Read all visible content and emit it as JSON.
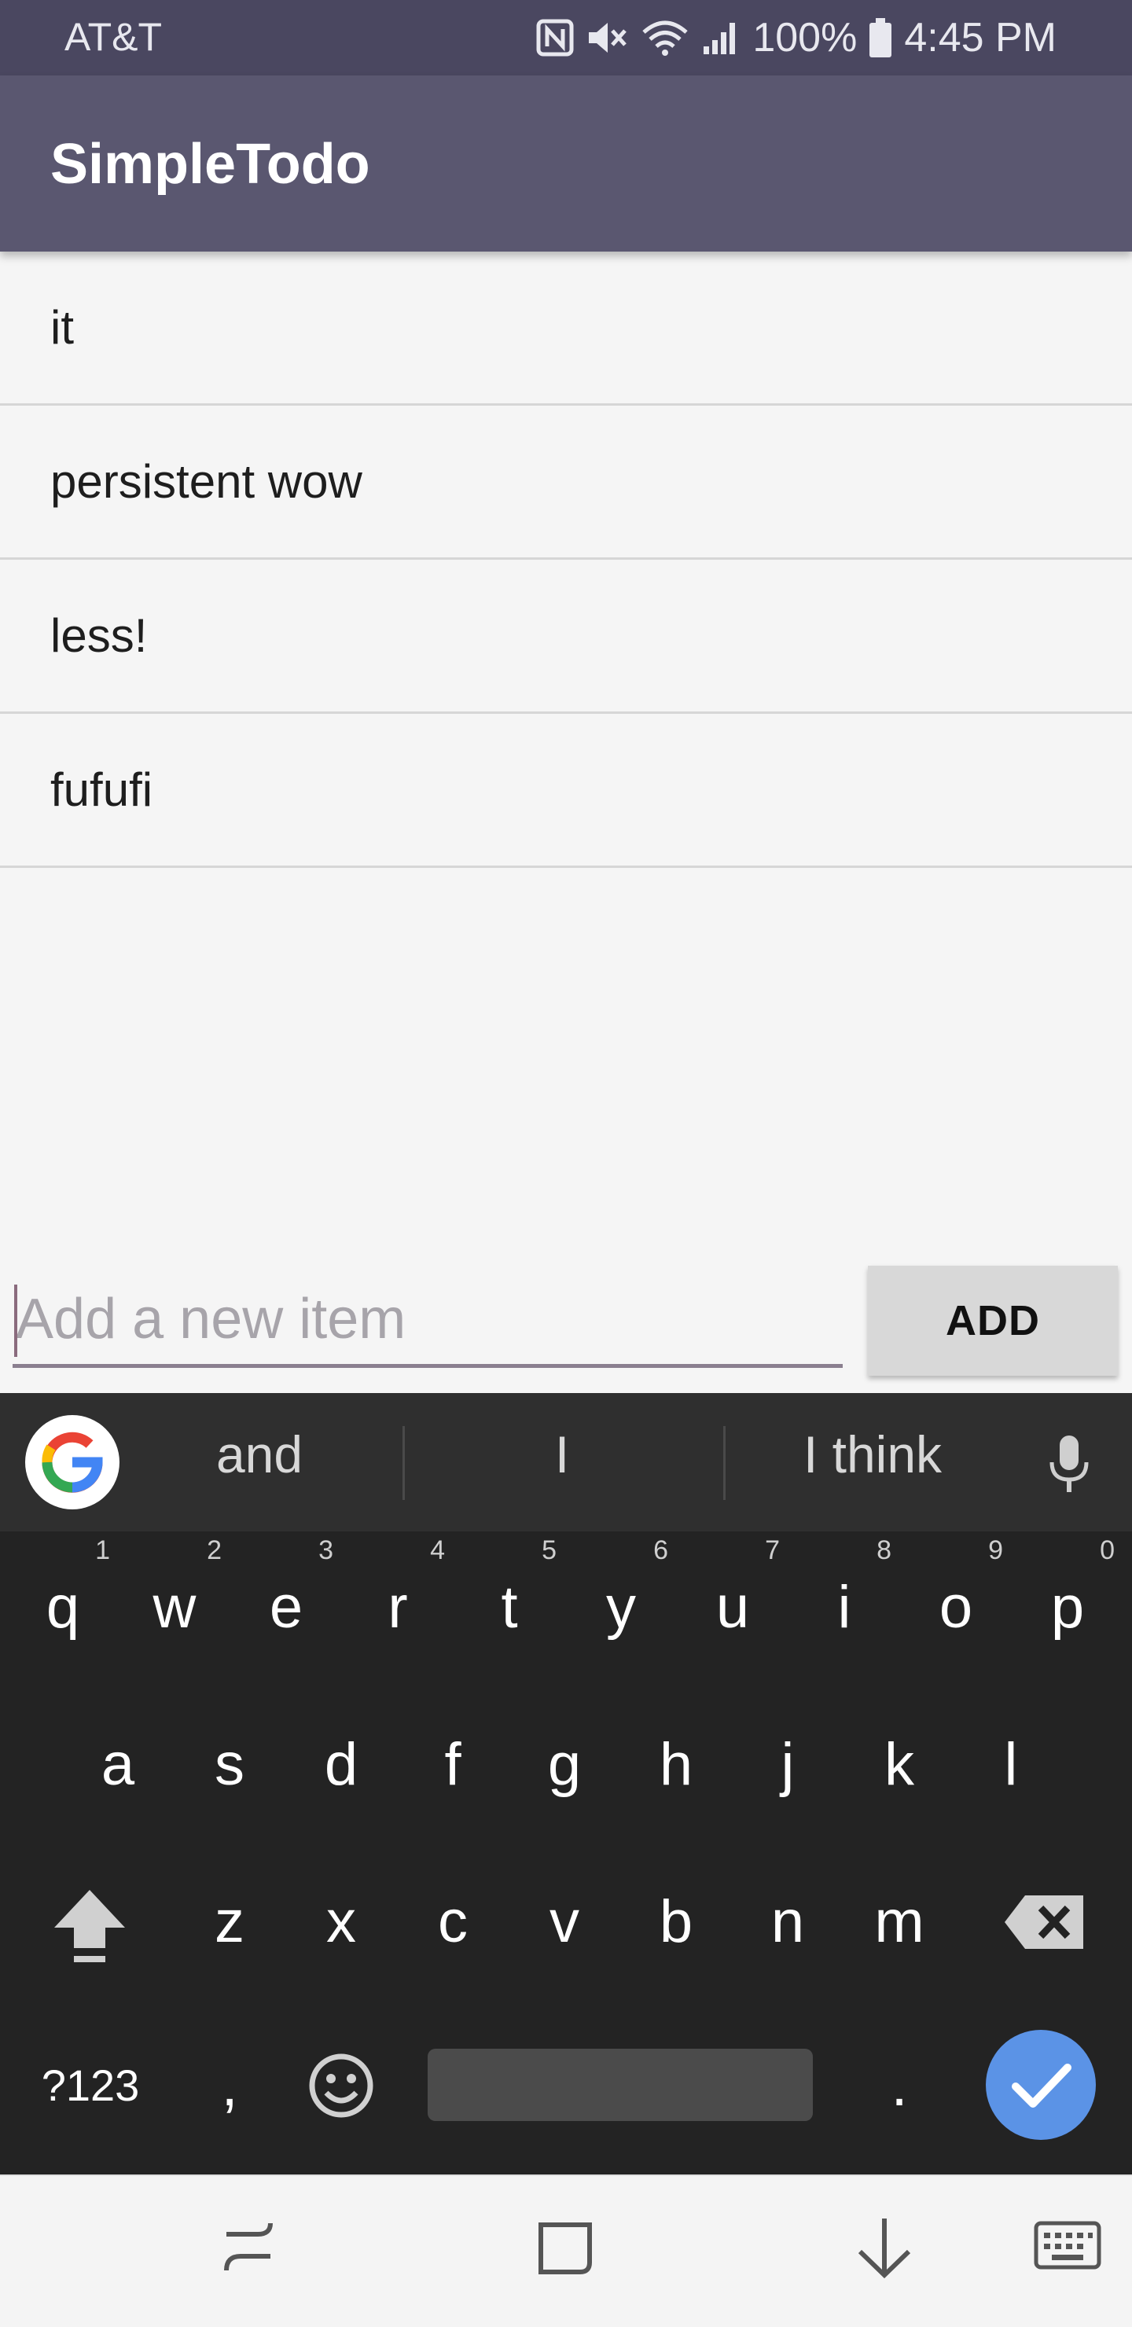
{
  "status_bar": {
    "carrier": "AT&T",
    "battery_percent": "100%",
    "time": "4:45 PM",
    "icons": [
      "nfc-icon",
      "mute-icon",
      "wifi-icon",
      "signal-icon",
      "battery-icon"
    ]
  },
  "app": {
    "title": "SimpleTodo",
    "accent": "#5a5770"
  },
  "todo_items": [
    {
      "label": "it"
    },
    {
      "label": "persistent wow"
    },
    {
      "label": "less!"
    },
    {
      "label": "fufufi"
    }
  ],
  "input": {
    "placeholder": "Add a new item",
    "value": "",
    "add_label": "ADD"
  },
  "keyboard": {
    "suggestions": [
      "and",
      "I",
      "I think"
    ],
    "row1": [
      {
        "key": "q",
        "hint": "1"
      },
      {
        "key": "w",
        "hint": "2"
      },
      {
        "key": "e",
        "hint": "3"
      },
      {
        "key": "r",
        "hint": "4"
      },
      {
        "key": "t",
        "hint": "5"
      },
      {
        "key": "y",
        "hint": "6"
      },
      {
        "key": "u",
        "hint": "7"
      },
      {
        "key": "i",
        "hint": "8"
      },
      {
        "key": "o",
        "hint": "9"
      },
      {
        "key": "p",
        "hint": "0"
      }
    ],
    "row2": [
      "a",
      "s",
      "d",
      "f",
      "g",
      "h",
      "j",
      "k",
      "l"
    ],
    "row3": [
      "z",
      "x",
      "c",
      "v",
      "b",
      "n",
      "m"
    ],
    "symbols_label": "?123",
    "comma_label": ",",
    "period_label": ".",
    "enter_color": "#5b93e6"
  },
  "nav_bar": {
    "buttons": [
      "recents-icon",
      "home-icon",
      "back-icon",
      "keyboard-switch-icon"
    ]
  }
}
